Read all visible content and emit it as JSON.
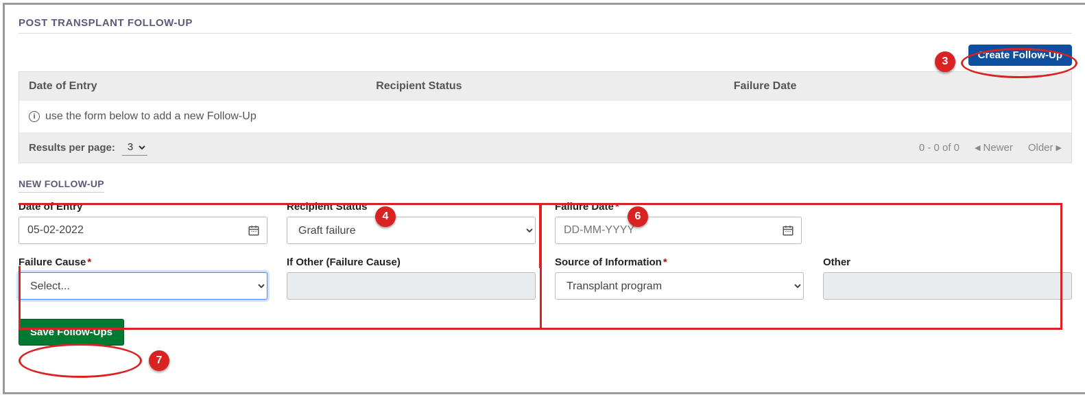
{
  "section_title": "POST TRANSPLANT FOLLOW-UP",
  "create_button": "Create Follow-Up",
  "table": {
    "headers": {
      "date": "Date of Entry",
      "status": "Recipient Status",
      "failure": "Failure Date"
    },
    "empty_message": "use the form below to add a new Follow-Up"
  },
  "pagination": {
    "results_label": "Results per page:",
    "results_value": "3",
    "range": "0 - 0 of 0",
    "newer": "Newer",
    "older": "Older"
  },
  "sub_title": "NEW FOLLOW-UP",
  "form": {
    "date_of_entry": {
      "label": "Date of Entry",
      "value": "05-02-2022"
    },
    "recipient_status": {
      "label": "Recipient Status",
      "value": "Graft failure"
    },
    "failure_date": {
      "label": "Failure Date",
      "placeholder": "DD-MM-YYYY"
    },
    "failure_cause": {
      "label": "Failure Cause",
      "value": "Select..."
    },
    "if_other_cause": {
      "label": "If Other (Failure Cause)"
    },
    "source_of_info": {
      "label": "Source of Information",
      "value": "Transplant program"
    },
    "other": {
      "label": "Other"
    }
  },
  "save_button": "Save Follow-Ups",
  "annotations": {
    "three": "3",
    "four": "4",
    "six": "6",
    "seven": "7"
  }
}
